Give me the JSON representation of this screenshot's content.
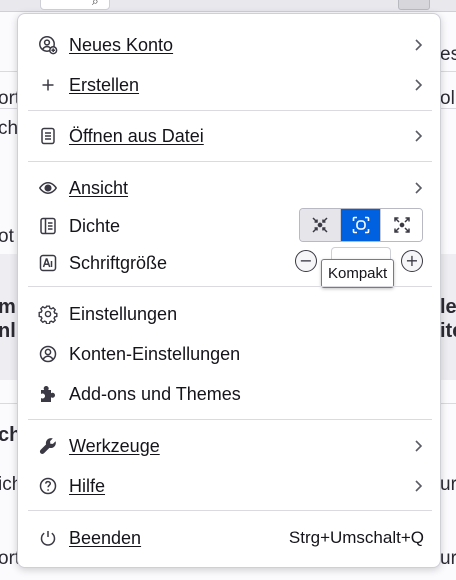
{
  "background": {
    "right_fragments": [
      "es",
      "ol",
      "le",
      "ite",
      "ur",
      "ur"
    ],
    "left_fragments": [
      "ort",
      "ch",
      "ot",
      "m",
      "nl",
      "ch",
      "ich",
      "orti"
    ]
  },
  "menu": {
    "items": [
      {
        "id": "new_account",
        "label": "Neues Konto",
        "icon": "account-add-icon",
        "submenu": true
      },
      {
        "id": "create",
        "label": "Erstellen",
        "icon": "plus-icon",
        "submenu": true
      },
      {
        "id": "open_file",
        "label": "Öffnen aus Datei",
        "icon": "file-icon",
        "submenu": true
      },
      {
        "id": "view",
        "label": "Ansicht",
        "icon": "eye-icon",
        "submenu": true
      },
      {
        "id": "density",
        "label": "Dichte",
        "icon": "density-icon",
        "submenu": false
      },
      {
        "id": "font_size",
        "label": "Schriftgröße",
        "icon": "font-size-icon",
        "submenu": false
      },
      {
        "id": "settings",
        "label": "Einstellungen",
        "icon": "gear-icon",
        "submenu": false
      },
      {
        "id": "account_settings",
        "label": "Konten-Einstellungen",
        "icon": "account-settings-icon",
        "submenu": false
      },
      {
        "id": "addons",
        "label": "Add-ons und Themes",
        "icon": "puzzle-icon",
        "submenu": false
      },
      {
        "id": "tools",
        "label": "Werkzeuge",
        "icon": "wrench-icon",
        "submenu": true
      },
      {
        "id": "help",
        "label": "Hilfe",
        "icon": "help-icon",
        "submenu": true
      },
      {
        "id": "quit",
        "label": "Beenden",
        "icon": "power-icon",
        "shortcut": "Strg+Umschalt+Q"
      }
    ],
    "density": {
      "options": [
        "compact-mode-icon",
        "touch-mode-icon",
        "normal-mode-icon"
      ],
      "selected_index": 1
    },
    "font_size": {
      "minus": "−",
      "plus": "+"
    },
    "tooltip": "Kompakt"
  },
  "colors": {
    "accent": "#0061e0",
    "panel_bg": "#ffffff",
    "text": "#15141a",
    "separator": "#dadae0"
  }
}
